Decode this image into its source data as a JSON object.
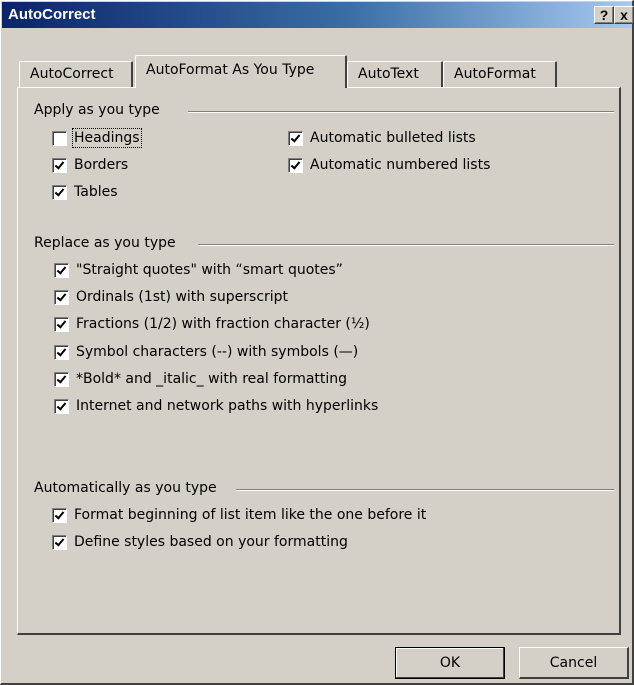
{
  "window": {
    "title": "AutoCorrect",
    "help_label": "?",
    "close_label": "x"
  },
  "tabs": [
    {
      "label": "AutoCorrect",
      "active": false
    },
    {
      "label": "AutoFormat As You Type",
      "active": true
    },
    {
      "label": "AutoText",
      "active": false
    },
    {
      "label": "AutoFormat",
      "active": false
    }
  ],
  "apply_group": {
    "label": "Apply as you type",
    "items": {
      "headings": {
        "label": "Headings",
        "checked": false
      },
      "borders": {
        "label": "Borders",
        "checked": true
      },
      "tables": {
        "label": "Tables",
        "checked": true
      },
      "bulleted": {
        "label": "Automatic bulleted lists",
        "checked": true
      },
      "numbered": {
        "label": "Automatic numbered lists",
        "checked": true
      }
    }
  },
  "replace_group": {
    "label": "Replace as you type",
    "items": {
      "quotes": {
        "label": "\"Straight quotes\" with “smart quotes”",
        "checked": true
      },
      "ordinals": {
        "label": "Ordinals (1st) with superscript",
        "checked": true
      },
      "fractions": {
        "label": "Fractions (1/2) with fraction character (½)",
        "checked": true
      },
      "symbols": {
        "label": "Symbol characters (--) with symbols (—)",
        "checked": true
      },
      "bold": {
        "label": "*Bold* and _italic_ with real formatting",
        "checked": true
      },
      "internet": {
        "label": "Internet and network paths with hyperlinks",
        "checked": true
      }
    }
  },
  "auto_group": {
    "label": "Automatically as you type",
    "items": {
      "format_list": {
        "label": "Format beginning of list item like the one before it",
        "checked": true
      },
      "define_styles": {
        "label": "Define styles based on your formatting",
        "checked": true
      }
    }
  },
  "buttons": {
    "ok": "OK",
    "cancel": "Cancel"
  }
}
